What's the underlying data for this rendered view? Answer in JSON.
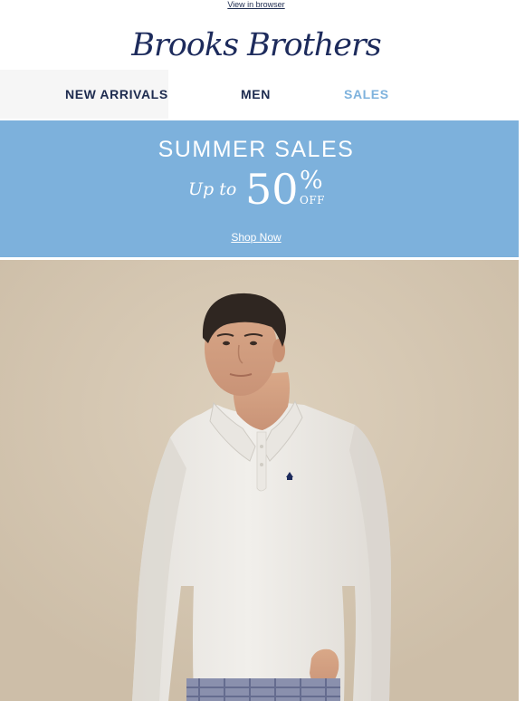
{
  "header": {
    "view_in_browser": "View in browser",
    "logo_text": "Brooks Brothers"
  },
  "nav": {
    "items": [
      {
        "label": "NEW ARRIVALS"
      },
      {
        "label": "MEN"
      },
      {
        "label": "SALES"
      }
    ]
  },
  "banner": {
    "title": "SUMMER SALES",
    "up_to": "Up to",
    "number": "50",
    "percent": "%",
    "off": "OFF",
    "cta": "Shop Now"
  },
  "colors": {
    "banner_bg": "#7db1dc",
    "nav_text": "#1d2b4f",
    "nav_active": "#7eb2dd",
    "hero_bg": "#d7c9b4",
    "logo_color": "#1d2b5c"
  }
}
